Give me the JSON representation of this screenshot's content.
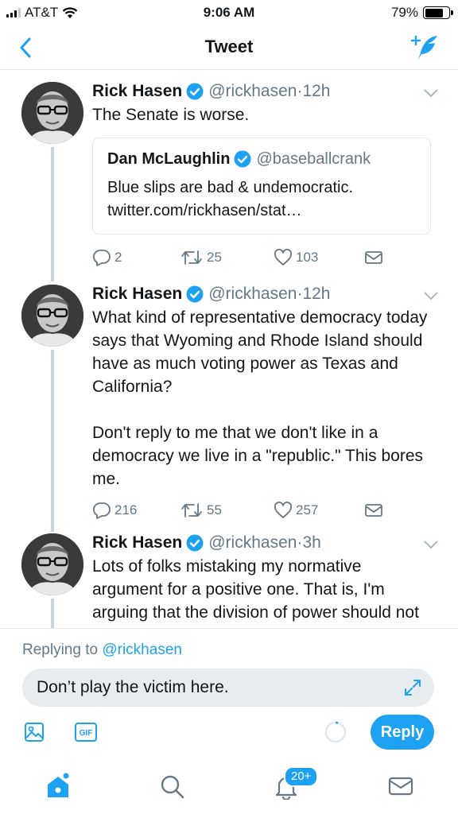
{
  "status_bar": {
    "carrier": "AT&T",
    "time": "9:06 AM",
    "battery": "79%",
    "battery_level": 0.79
  },
  "nav": {
    "title": "Tweet"
  },
  "tweets": [
    {
      "name": "Rick Hasen",
      "handle": "@rickhasen",
      "sep": "·",
      "age": "12h",
      "text": "The Senate is worse.",
      "quote": {
        "name": "Dan McLaughlin",
        "handle": "@baseballcrank",
        "text": "Blue slips are bad & undemocratic.\ntwitter.com/rickhasen/stat…"
      },
      "replies": "2",
      "retweets": "25",
      "likes": "103"
    },
    {
      "name": "Rick Hasen",
      "handle": "@rickhasen",
      "sep": "·",
      "age": "12h",
      "text": "What kind of representative democracy today says that Wyoming and Rhode Island should have as much voting power as Texas and California?\n\nDon't reply to me that we don't like in a democracy we live in a \"republic.\" This bores me.",
      "replies": "216",
      "retweets": "55",
      "likes": "257"
    },
    {
      "name": "Rick Hasen",
      "handle": "@rickhasen",
      "sep": "·",
      "age": "3h",
      "text": "Lots of folks mistaking my normative argument for a positive one. That is, I'm arguing that the division of power should not be this way given today's conditions..."
    }
  ],
  "reply": {
    "replying_prefix": "Replying to",
    "replying_to": "@rickhasen",
    "input_value": "Don’t play the victim here.",
    "button_label": "Reply",
    "gif_label": "GIF"
  },
  "tab_bar": {
    "notifications_badge": "20+"
  },
  "colors": {
    "accent": "#1da1f2",
    "secondary_text": "#657786",
    "border": "#e1e8ed"
  }
}
